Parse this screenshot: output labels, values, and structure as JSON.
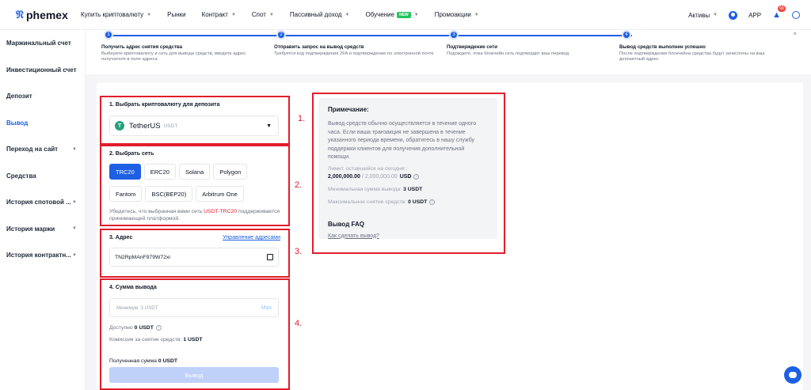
{
  "brand": {
    "name": "phemex",
    "mark": "𝔑"
  },
  "nav": {
    "items": [
      {
        "label": "Купить криптовалюту",
        "caret": true
      },
      {
        "label": "Рынки",
        "caret": false
      },
      {
        "label": "Контракт",
        "caret": true
      },
      {
        "label": "Спот",
        "caret": true
      },
      {
        "label": "Пассивный доход",
        "caret": true
      },
      {
        "label": "Обучение",
        "caret": true,
        "badge": "NEW"
      },
      {
        "label": "Промоакции",
        "caret": true
      }
    ],
    "assets": "Активы",
    "app": "APP",
    "notif_count": "99"
  },
  "sidebar": {
    "items": [
      {
        "label": "Маржинальный счет",
        "caret": false
      },
      {
        "label": "Инвестиционный счет",
        "caret": false
      },
      {
        "label": "Депозит",
        "caret": false
      },
      {
        "label": "Вывод",
        "caret": false,
        "active": true
      },
      {
        "label": "Переход на сайт",
        "caret": true
      },
      {
        "label": "Средства",
        "caret": false
      },
      {
        "label": "История спотовой ...",
        "caret": true
      },
      {
        "label": "История маржи",
        "caret": true
      },
      {
        "label": "История контрактн...",
        "caret": true
      }
    ]
  },
  "steps": [
    {
      "num": "1",
      "title": "Получить адрес снятия средства",
      "desc": "Выберите криптовалюту и сеть для вывода средств, введите адрес получателя в поле адреса"
    },
    {
      "num": "2",
      "title": "Отправить запрос на вывод средств",
      "desc": "Требуется код подтверждения 2FA и подтверждение по электронной почте"
    },
    {
      "num": "3",
      "title": "Подтверждение сети",
      "desc": "Подождите, пока блокчейн сеть подтвердит ваш перевод"
    },
    {
      "num": "4",
      "title": "Вывод средств выполнен успешно",
      "desc": "После подтверждения блокчейна средства будут зачислены на ваш депозитный адрес"
    }
  ],
  "markers": [
    "1.",
    "2.",
    "3.",
    "4."
  ],
  "section1": {
    "title": "1. Выбрать криптовалюту для депозита",
    "coin_name": "TetherUS",
    "coin_symbol": "USDT",
    "coin_glyph": "T"
  },
  "section2": {
    "title": "2. Выбрать сеть",
    "networks": [
      "TRC20",
      "ERC20",
      "Solana",
      "Polygon",
      "Fantom",
      "BSC(BEP20)",
      "Arbitrum One"
    ],
    "selected": "TRC20",
    "warn_pre": "Убедитесь, что выбранная вами сеть ",
    "warn_hl": "USDT-TRC20",
    "warn_post": " поддерживается принимающей платформой."
  },
  "section3": {
    "title": "3. Адрес",
    "manage_link": "Управление адресами",
    "address": "TN2RpMAnF979W72xi"
  },
  "section4": {
    "title": "4. Сумма вывода",
    "placeholder": "Минимум: 3 USDT",
    "max": "Max",
    "available_label": "Доступно",
    "available_value": "0 USDT",
    "fee_label": "Комиссия за снятие средств:",
    "fee_value": "1 USDT",
    "received_label": "Полученная сумма",
    "received_value": "0 USDT",
    "submit": "Вывод"
  },
  "note": {
    "title": "Примечание:",
    "text": "Вывод средств обычно осуществляется в течение одного часа. Если ваша транзакция не завершена в течение указанного периода времени, обратитесь в нашу службу поддержки клиентов для получения дополнительной помощи.",
    "limit_label": "Лимит, оставшийся на сегодня::",
    "limit_used": "2,000,000.00",
    "limit_total": "2,000,000.00",
    "limit_unit": "USD",
    "min_label": "Минимальная сумма вывода:",
    "min_value": "3 USDT",
    "max_label": "Максимальное снятие средств:",
    "max_value": "0 USDT",
    "faq_title": "Вывод FAQ",
    "faq_link": "Как сделать вывод?"
  }
}
